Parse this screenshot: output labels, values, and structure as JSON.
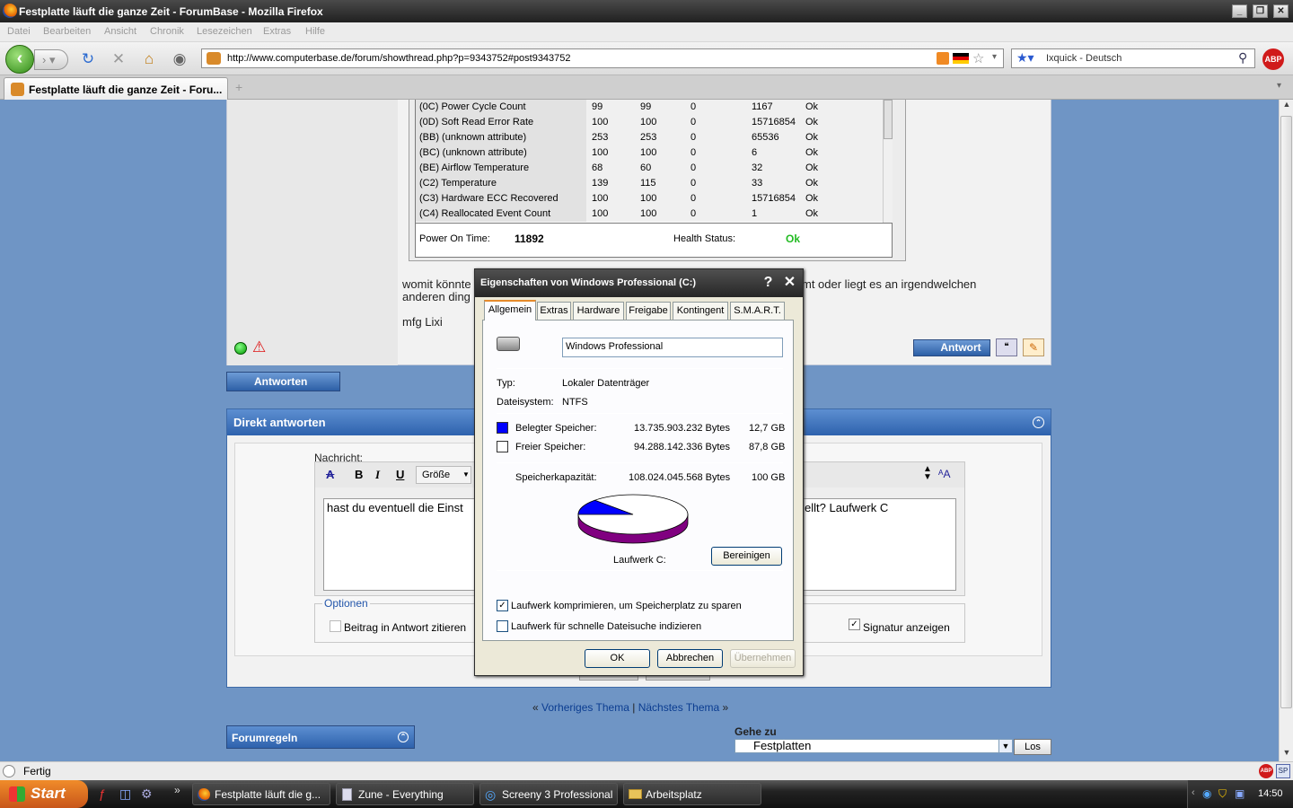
{
  "window": {
    "title": "Festplatte läuft die ganze Zeit - ForumBase - Mozilla Firefox"
  },
  "menu": [
    "Datei",
    "Bearbeiten",
    "Ansicht",
    "Chronik",
    "Lesezeichen",
    "Extras",
    "Hilfe"
  ],
  "nav": {
    "url": "http://www.computerbase.de/forum/showthread.php?p=9343752#post9343752",
    "search_placeholder": "Ixquick - Deutsch"
  },
  "tab": {
    "label": "Festplatte läuft die ganze Zeit - Foru..."
  },
  "smart": {
    "rows": [
      [
        "(0C) Power Cycle Count",
        "99",
        "99",
        "0",
        "1167",
        "Ok"
      ],
      [
        "(0D) Soft Read Error Rate",
        "100",
        "100",
        "0",
        "15716854",
        "Ok"
      ],
      [
        "(BB) (unknown attribute)",
        "253",
        "253",
        "0",
        "65536",
        "Ok"
      ],
      [
        "(BC) (unknown attribute)",
        "100",
        "100",
        "0",
        "6",
        "Ok"
      ],
      [
        "(BE) Airflow Temperature",
        "68",
        "60",
        "0",
        "32",
        "Ok"
      ],
      [
        "(C2) Temperature",
        "139",
        "115",
        "0",
        "33",
        "Ok"
      ],
      [
        "(C3) Hardware ECC Recovered",
        "100",
        "100",
        "0",
        "15716854",
        "Ok"
      ],
      [
        "(C4) Reallocated Event Count",
        "100",
        "100",
        "0",
        "1",
        "Ok"
      ]
    ],
    "power_on_label": "Power On Time:",
    "power_on_value": "11892",
    "health_label": "Health Status:",
    "health_value": "Ok"
  },
  "post": {
    "line1_left": "womit könnte",
    "line1_right": "mt oder liegt es an irgendwelchen",
    "line2": "anderen ding",
    "sign": "mfg Lixi",
    "reply_btn": "Antwort"
  },
  "antworten_btn": "Antworten",
  "direkt": {
    "title": "Direkt antworten",
    "nachricht_label": "Nachricht:",
    "size_label": "Größe",
    "bold": "B",
    "italic": "I",
    "underline": "U",
    "text_left": "hast du eventuell die Einst",
    "text_right": "ellt? Laufwerk C",
    "options_label": "Optionen",
    "opt_quote": "Beitrag in Antwort zitieren",
    "opt_signature": "Signatur anzeigen"
  },
  "threadnav": {
    "prev": "Vorheriges Thema",
    "sep": "|",
    "next": "Nächstes Thema"
  },
  "forumregeln": "Forumregeln",
  "gehezu": {
    "label": "Gehe zu",
    "selected": "Festplatten",
    "button": "Los"
  },
  "dialog": {
    "title": "Eigenschaften von Windows Professional (C:)",
    "tabs": [
      "Allgemein",
      "Extras",
      "Hardware",
      "Freigabe",
      "Kontingent",
      "S.M.A.R.T."
    ],
    "name_value": "Windows Professional",
    "typ_label": "Typ:",
    "typ_value": "Lokaler Datenträger",
    "fs_label": "Dateisystem:",
    "fs_value": "NTFS",
    "used_label": "Belegter Speicher:",
    "used_bytes": "13.735.903.232 Bytes",
    "used_gb": "12,7 GB",
    "free_label": "Freier Speicher:",
    "free_bytes": "94.288.142.336 Bytes",
    "free_gb": "87,8 GB",
    "cap_label": "Speicherkapazität:",
    "cap_bytes": "108.024.045.568 Bytes",
    "cap_gb": "100 GB",
    "drive_label": "Laufwerk C:",
    "cleanup_btn": "Bereinigen",
    "compress_label": "Laufwerk komprimieren, um Speicherplatz zu sparen",
    "index_label": "Laufwerk für schnelle Dateisuche indizieren",
    "ok_btn": "OK",
    "cancel_btn": "Abbrechen",
    "apply_btn": "Übernehmen",
    "used_color": "#0000ff",
    "free_color": "#ffffff"
  },
  "status": {
    "text": "Fertig"
  },
  "taskbar": {
    "start": "Start",
    "items": [
      "Festplatte läuft die g...",
      "Zune - Everything",
      "Screeny 3 Professional",
      "Arbeitsplatz"
    ],
    "clock": "14:50"
  }
}
